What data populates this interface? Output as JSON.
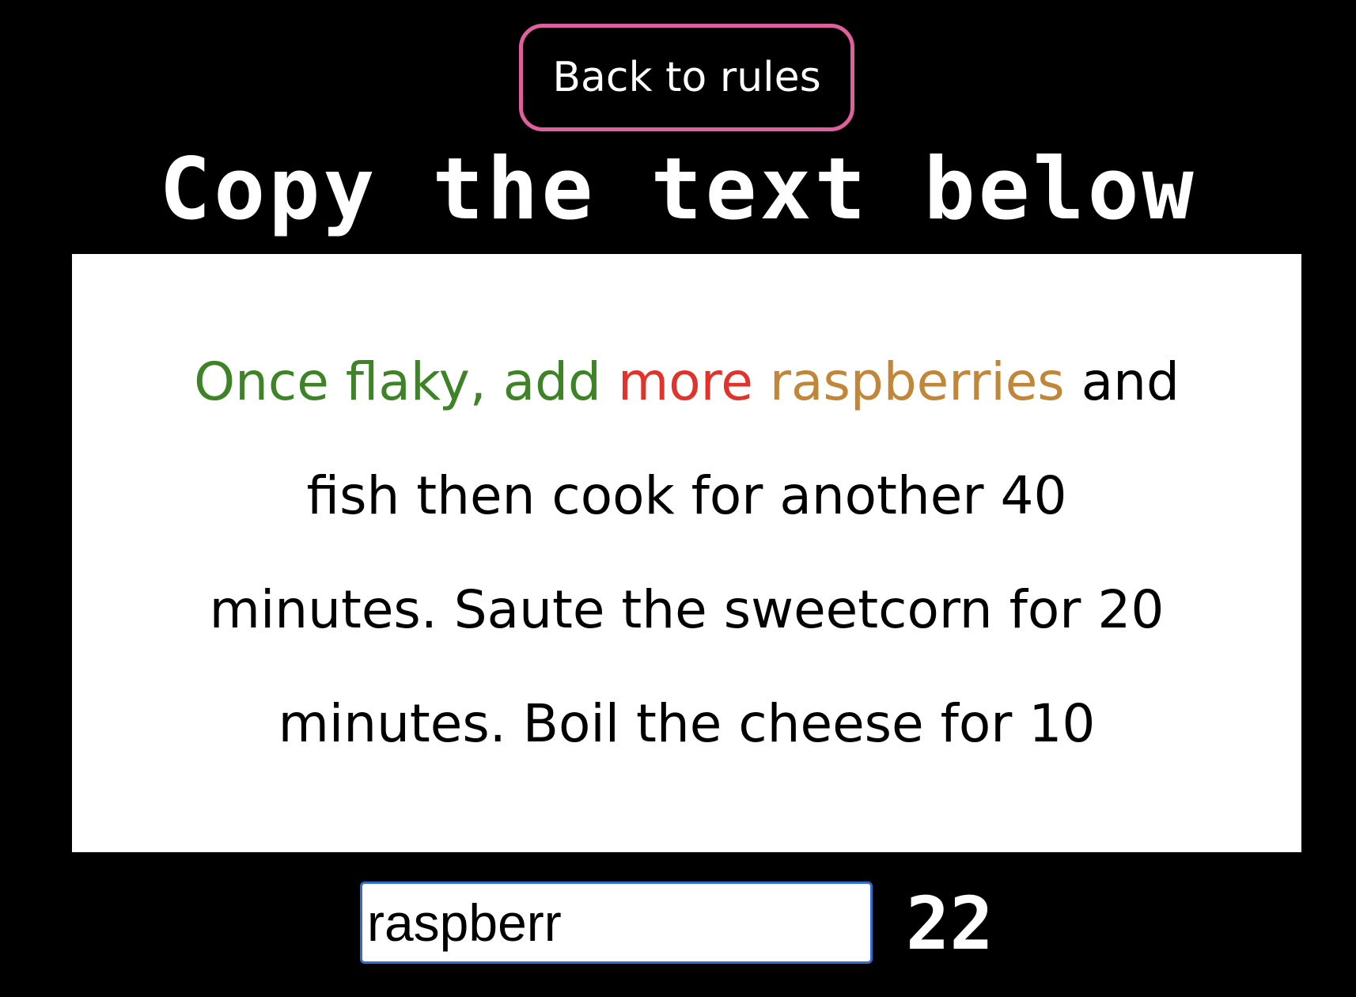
{
  "back_button": {
    "label": "Back to rules"
  },
  "heading": "Copy the text below",
  "passage": {
    "completed": "Once flaky, add",
    "wrong": "more",
    "current": "raspberries",
    "remaining": "and fish then cook for another 40 minutes. Saute the sweetcorn for 20 minutes. Boil the cheese for 10"
  },
  "input": {
    "value": "raspberr"
  },
  "counter": "22",
  "colors": {
    "completed": "#3e8427",
    "wrong": "#e2332a",
    "current": "#c18638",
    "button_border": "#e0609e",
    "input_border": "#2f6ecf"
  }
}
